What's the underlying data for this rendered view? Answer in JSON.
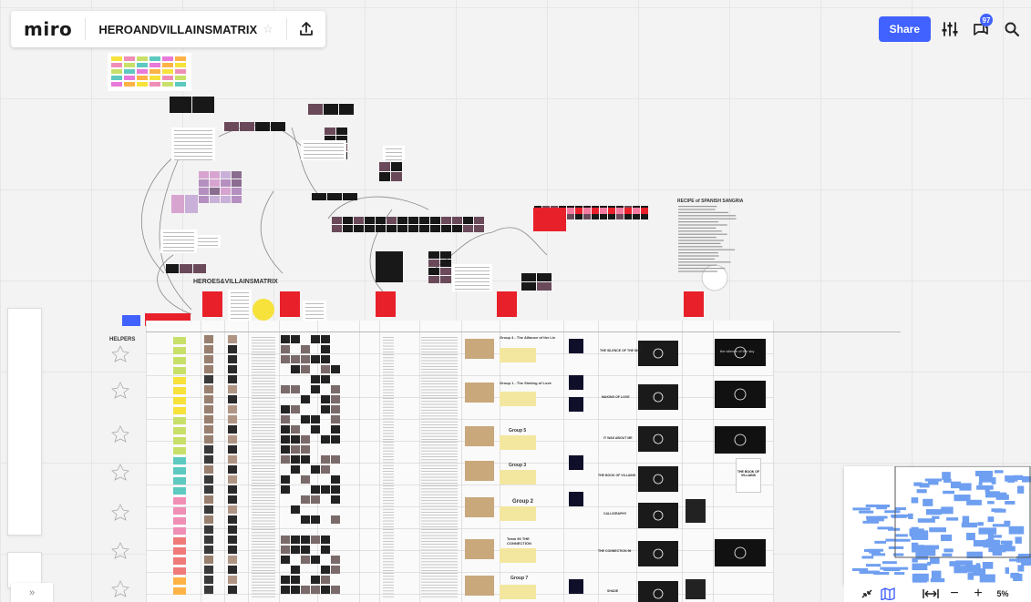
{
  "app": {
    "logo": "miro",
    "board_title": "HEROANDVILLAINSMATRIX",
    "star_glyph": "☆"
  },
  "toolbar_right": {
    "share_label": "Share",
    "notifications_count": "97"
  },
  "zoom": {
    "level": "5%",
    "minus": "−",
    "plus": "+"
  },
  "sidebar_toggle": "»",
  "board": {
    "matrix_title": "HEROES&VILLAINSMATRIX",
    "helpers_label": "HELPERS",
    "recipe_title": "RECIPE of SPANISH SANGRIA",
    "groups": [
      "Group 4 - The Alliance of the Lie",
      "Group 1 - The Sinking of Love",
      "Group 5",
      "Group 3",
      "Group 2",
      "Team 96 THE CONNECTION",
      "Group 7"
    ],
    "row_titles": [
      "THE SILENCE OF THE SKY",
      "MAKING OF LOVE",
      "IT WAS ABOUT ME",
      "THE BOOK OF VILLAINS",
      "CALLIGRAPHY",
      "THE CONNECTION 96",
      "SHADE"
    ],
    "video_caption": "the silence of the sky",
    "book_title": "THE BOOK OF VILLAINS"
  },
  "colors": {
    "accent": "#4262ff",
    "red_card": "#e8202a",
    "sticky_yellow": "#f6e23b",
    "sticky_pink": "#f08fb5",
    "sticky_green": "#c8e06a",
    "sticky_teal": "#5ec9c0",
    "minimap_blue": "#6f9ff0"
  }
}
